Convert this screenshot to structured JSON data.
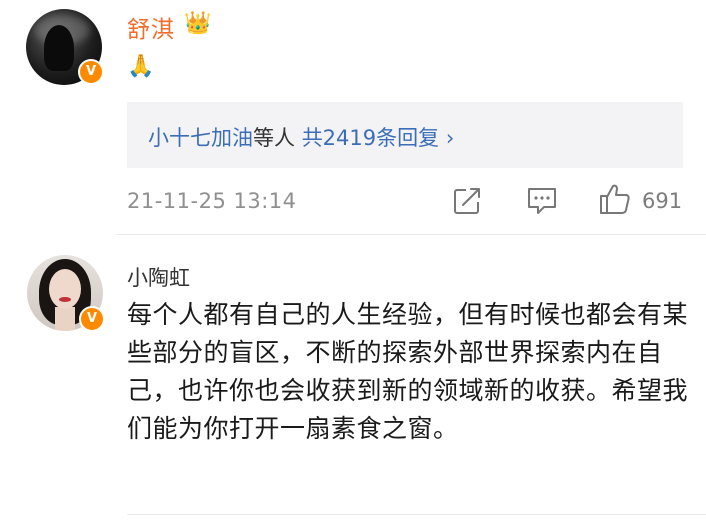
{
  "comment1": {
    "username": "舒淇",
    "crown_icon": "👑",
    "verified_badge": "V",
    "content": "🙏",
    "reply_summary": {
      "replier": "小十七加油",
      "suffix": "等人",
      "count_text": "共2419条回复",
      "chevron": "›"
    },
    "timestamp": "21-11-25 13:14",
    "like_count": "691",
    "icons": [
      "avatar",
      "verified-badge-icon",
      "crown-icon",
      "share-icon",
      "comment-icon",
      "like-icon"
    ]
  },
  "comment2": {
    "username": "小陶虹",
    "verified_badge": "V",
    "content": "每个人都有自己的人生经验，但有时候也都会有某些部分的盲区，不断的探索外部世界探索内在自己，也许你也会收获到新的领域新的收获。希望我们能为你打开一扇素食之窗。"
  },
  "colors": {
    "vip_name": "#f26d2b",
    "link_blue": "#3b6eb7",
    "badge_orange": "#ff8a00",
    "reply_bg": "#f3f3f6",
    "meta_gray": "#8f8f8f"
  }
}
